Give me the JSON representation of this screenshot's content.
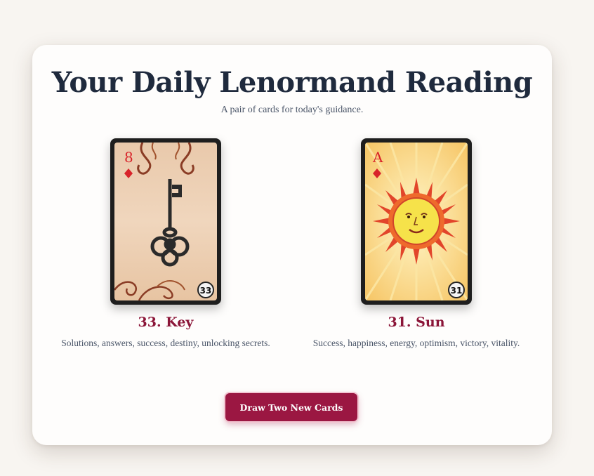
{
  "header": {
    "title": "Your Daily Lenormand Reading",
    "subtitle": "A pair of cards for today's guidance."
  },
  "cards": [
    {
      "name": "33. Key",
      "description": "Solutions, answers, success, destiny, unlocking secrets.",
      "rank": "8",
      "suit": "diamonds",
      "number": "33",
      "image": "key-icon"
    },
    {
      "name": "31. Sun",
      "description": "Success, happiness, energy, optimism, victory, vitality.",
      "rank": "A",
      "suit": "diamonds",
      "number": "31",
      "image": "sun-icon"
    }
  ],
  "actions": {
    "draw_label": "Draw Two New Cards"
  },
  "colors": {
    "accent": "#9b1742",
    "card_name": "#8b1538",
    "title": "#1f2a3d"
  }
}
